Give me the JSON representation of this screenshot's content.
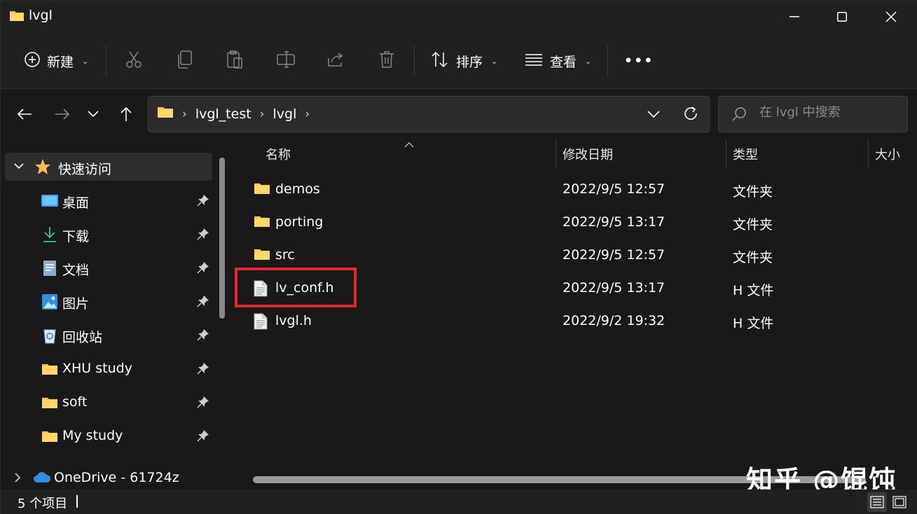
{
  "window": {
    "title": "lvgl",
    "controls": [
      "minimize",
      "maximize",
      "close"
    ]
  },
  "toolbar": {
    "new_label": "新建",
    "sort_label": "排序",
    "view_label": "查看",
    "more_label": "•••",
    "icons": [
      "plus-circle-icon",
      "cut-icon",
      "copy-icon",
      "paste-icon",
      "rename-icon",
      "share-icon",
      "delete-icon",
      "sort-icon",
      "view-icon"
    ]
  },
  "nav": {
    "breadcrumbs": [
      "lvgl_test",
      "lvgl"
    ],
    "search_placeholder": "在 lvgl 中搜索"
  },
  "sidebar": {
    "quick_access_label": "快速访问",
    "items": [
      {
        "label": "桌面",
        "icon": "desktop-icon",
        "pinned": true
      },
      {
        "label": "下载",
        "icon": "download-icon",
        "pinned": true
      },
      {
        "label": "文档",
        "icon": "document-icon",
        "pinned": true
      },
      {
        "label": "图片",
        "icon": "picture-icon",
        "pinned": true
      },
      {
        "label": "回收站",
        "icon": "recycle-bin-icon",
        "pinned": true
      },
      {
        "label": "XHU study",
        "icon": "folder-icon",
        "pinned": true
      },
      {
        "label": "soft",
        "icon": "folder-icon",
        "pinned": true
      },
      {
        "label": "My study",
        "icon": "folder-icon",
        "pinned": true
      }
    ],
    "onedrive_label": "OneDrive - 61724z"
  },
  "file_list": {
    "columns": {
      "name": "名称",
      "date": "修改日期",
      "type": "类型",
      "size": "大小"
    },
    "rows": [
      {
        "name": "demos",
        "date": "2022/9/5 12:57",
        "type": "文件夹",
        "kind": "folder"
      },
      {
        "name": "porting",
        "date": "2022/9/5 13:17",
        "type": "文件夹",
        "kind": "folder"
      },
      {
        "name": "src",
        "date": "2022/9/5 12:57",
        "type": "文件夹",
        "kind": "folder"
      },
      {
        "name": "lv_conf.h",
        "date": "2022/9/5 13:17",
        "type": "H 文件",
        "kind": "file",
        "highlighted": true
      },
      {
        "name": "lvgl.h",
        "date": "2022/9/2 19:32",
        "type": "H 文件",
        "kind": "file"
      }
    ],
    "highlight_color": "#e8252d"
  },
  "status": {
    "item_count": "5 个项目"
  },
  "watermark": "知乎 @馄饨",
  "colors": {
    "background": "#191919",
    "chrome": "#202020",
    "folder_yellow": "#f6c744",
    "accent_blue": "#4cc2ff"
  }
}
